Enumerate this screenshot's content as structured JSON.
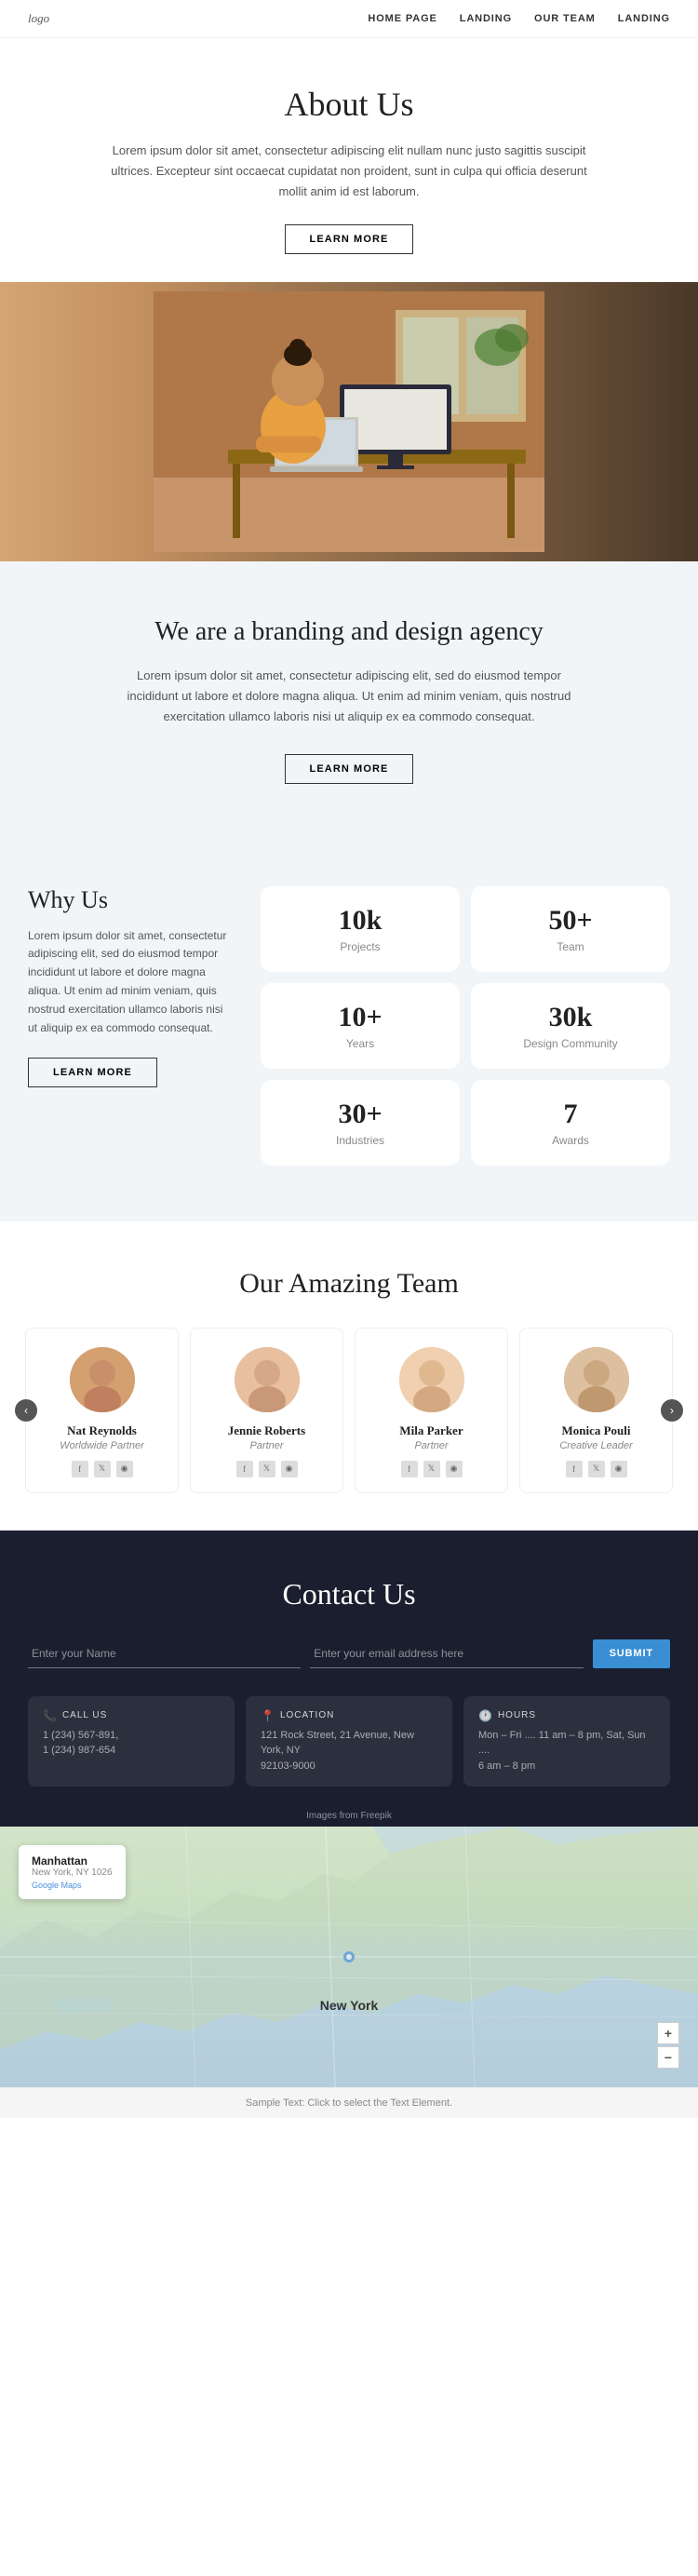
{
  "nav": {
    "logo": "logo",
    "links": [
      {
        "label": "HOME PAGE",
        "href": "#"
      },
      {
        "label": "LANDING",
        "href": "#"
      },
      {
        "label": "OUR TEAM",
        "href": "#"
      },
      {
        "label": "LANDING",
        "href": "#"
      }
    ]
  },
  "about": {
    "title": "About Us",
    "description": "Lorem ipsum dolor sit amet, consectetur adipiscing elit nullam nunc justo sagittis suscipit ultrices. Excepteur sint occaecat cupidatat non proident, sunt in culpa qui officia deserunt mollit anim id est laborum.",
    "learn_more": "LEARN MORE"
  },
  "branding": {
    "title": "We are a branding and design agency",
    "description": "Lorem ipsum dolor sit amet, consectetur adipiscing elit, sed do eiusmod tempor incididunt ut labore et dolore magna aliqua. Ut enim ad minim veniam, quis nostrud exercitation ullamco laboris nisi ut aliquip ex ea commodo consequat.",
    "learn_more": "LEARN MORE"
  },
  "why_us": {
    "title": "Why Us",
    "description": "Lorem ipsum dolor sit amet, consectetur adipiscing elit, sed do eiusmod tempor incididunt ut labore et dolore magna aliqua. Ut enim ad minim veniam, quis nostrud exercitation ullamco laboris nisi ut aliquip ex ea commodo consequat.",
    "learn_more": "LEARN MORE",
    "stats": [
      {
        "number": "10k",
        "label": "Projects"
      },
      {
        "number": "50+",
        "label": "Team"
      },
      {
        "number": "10+",
        "label": "Years"
      },
      {
        "number": "30k",
        "label": "Design Community"
      },
      {
        "number": "30+",
        "label": "Industries"
      },
      {
        "number": "7",
        "label": "Awards"
      }
    ]
  },
  "team": {
    "title": "Our Amazing Team",
    "members": [
      {
        "name": "Nat Reynolds",
        "role": "Worldwide Partner",
        "avatar_type": "male"
      },
      {
        "name": "Jennie Roberts",
        "role": "Partner",
        "avatar_type": "female1"
      },
      {
        "name": "Mila Parker",
        "role": "Partner",
        "avatar_type": "female2"
      },
      {
        "name": "Monica Pouli",
        "role": "Creative Leader",
        "avatar_type": "female3"
      }
    ],
    "social": [
      "f",
      "y",
      "o"
    ]
  },
  "contact": {
    "title": "Contact Us",
    "form": {
      "name_placeholder": "Enter your Name",
      "email_placeholder": "Enter your email address here",
      "submit_label": "SUBMIT"
    },
    "info_cards": [
      {
        "icon": "📞",
        "title": "CALL US",
        "lines": [
          "1 (234) 567-891,",
          "1 (234) 987-654"
        ]
      },
      {
        "icon": "📍",
        "title": "LOCATION",
        "lines": [
          "121 Rock Street, 21 Avenue, New York, NY",
          "92103-9000"
        ]
      },
      {
        "icon": "🕐",
        "title": "HOURS",
        "lines": [
          "Mon – Fri .... 11 am – 8 pm, Sat, Sun ....",
          "6 am – 8 pm"
        ]
      }
    ]
  },
  "map": {
    "overlay": {
      "city": "Manhattan",
      "address": "New York, NY 1026",
      "link": "Google Maps"
    },
    "label": "New York",
    "zoom_plus": "+",
    "zoom_minus": "−"
  },
  "footer": {
    "freepik_text": "Images from Freepik",
    "sample_text": "Sample Text: Click to select the Text Element."
  }
}
